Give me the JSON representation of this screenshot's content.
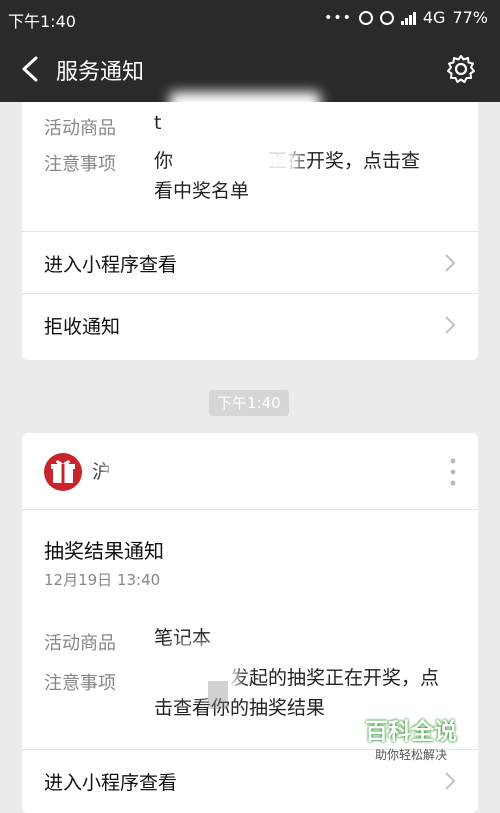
{
  "status_bar": {
    "time": "下午1:40",
    "network": "4G",
    "battery": "77%"
  },
  "nav": {
    "title": "服务通知"
  },
  "card_top": {
    "product_label": "活动商品",
    "product_value": "t",
    "notice_label": "注意事项",
    "notice_line1": "你　　　　　正在开奖，点击查",
    "notice_line2": "看中奖名单",
    "open_miniprogram": "进入小程序查看",
    "reject_notice": "拒收通知"
  },
  "time_divider": "下午1:40",
  "card_bottom": {
    "sender_name": "沪",
    "title": "抽奖结果通知",
    "datetime": "12月19日  13:40",
    "product_label": "活动商品",
    "product_value": "笔记本",
    "notice_label": "注意事项",
    "notice_line1": "　　　　发起的抽奖正在开奖，点",
    "notice_line2": "击查看你的抽奖结果",
    "open_miniprogram": "进入小程序查看"
  },
  "watermark": {
    "title": "百科全说",
    "subtitle": "助你轻松解决"
  },
  "colors": {
    "bar": "#2a2a2a",
    "background": "#ececec",
    "avatar": "#c8242a"
  }
}
